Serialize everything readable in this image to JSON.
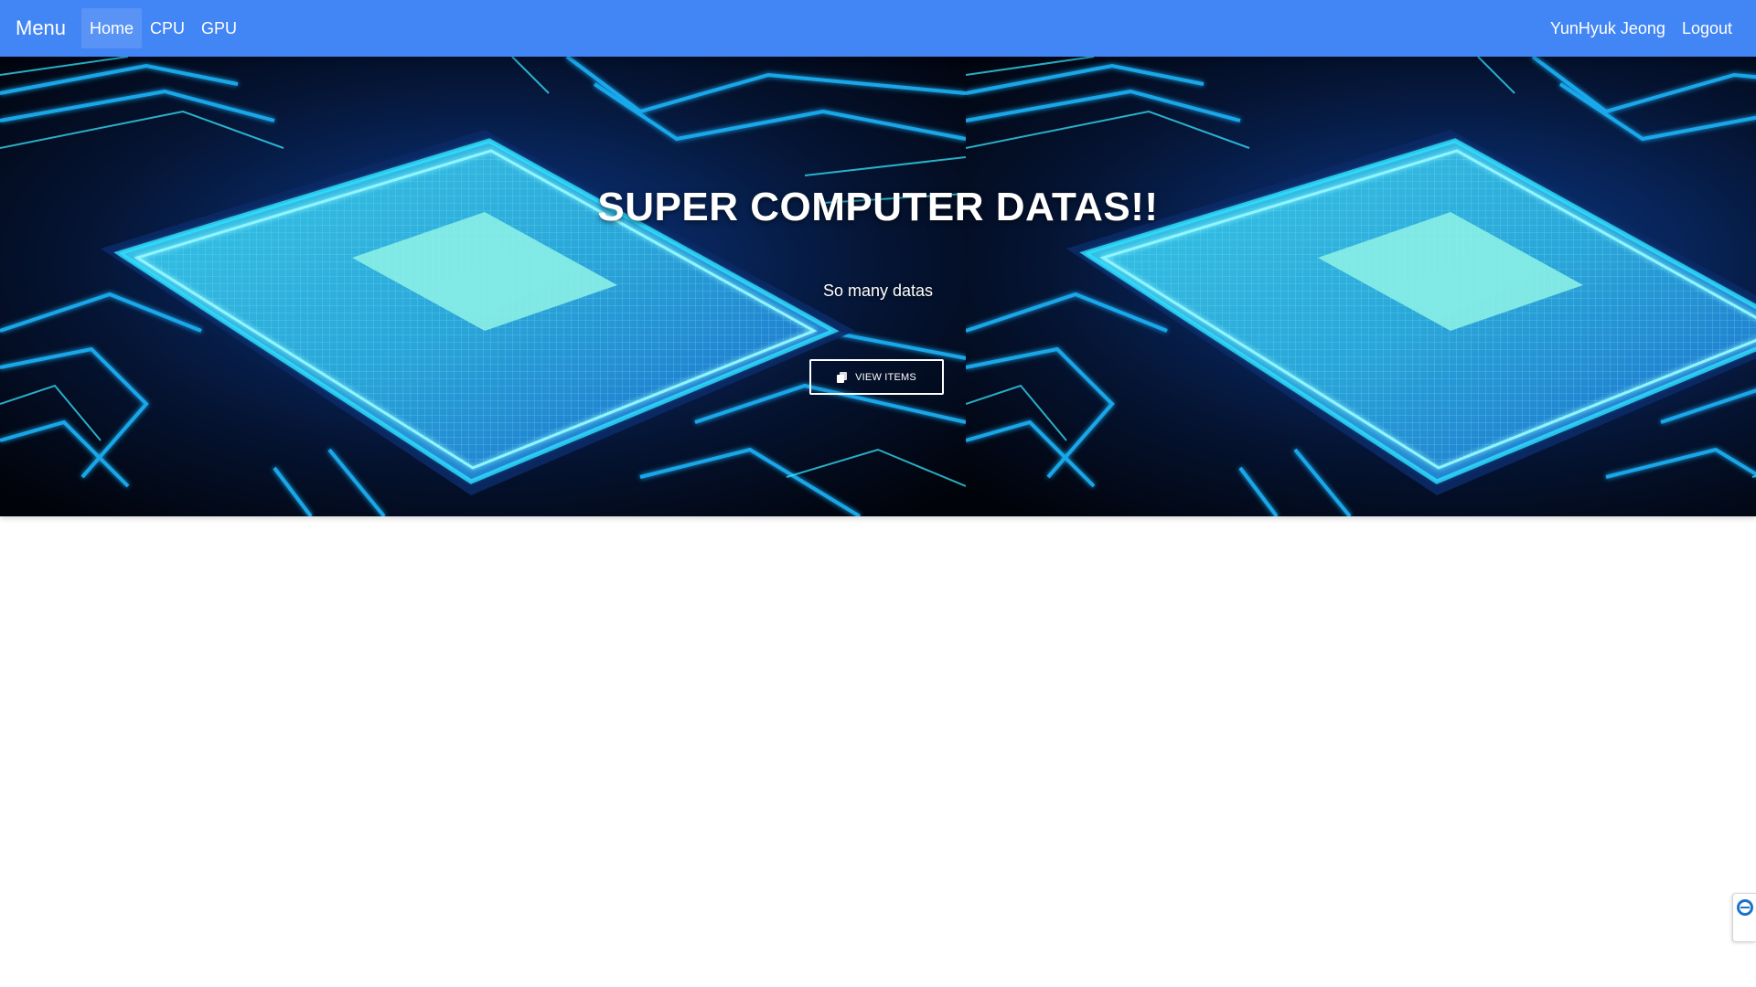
{
  "navbar": {
    "brand": "Menu",
    "links": [
      {
        "label": "Home",
        "active": true
      },
      {
        "label": "CPU",
        "active": false
      },
      {
        "label": "GPU",
        "active": false
      }
    ],
    "user_name": "YunHyuk Jeong",
    "logout_label": "Logout"
  },
  "hero": {
    "title": "SUPER COMPUTER DATAS!!",
    "subtitle": "So many datas",
    "button_label": "VIEW ITEMS",
    "button_icon": "copy-icon"
  },
  "widget": {
    "icon": "remote-support-icon"
  },
  "colors": {
    "navbar": "#4285f4",
    "circuit_glow": "#21d4ff",
    "chip_core": "#7ff3ec",
    "background_dark": "#02050c"
  }
}
